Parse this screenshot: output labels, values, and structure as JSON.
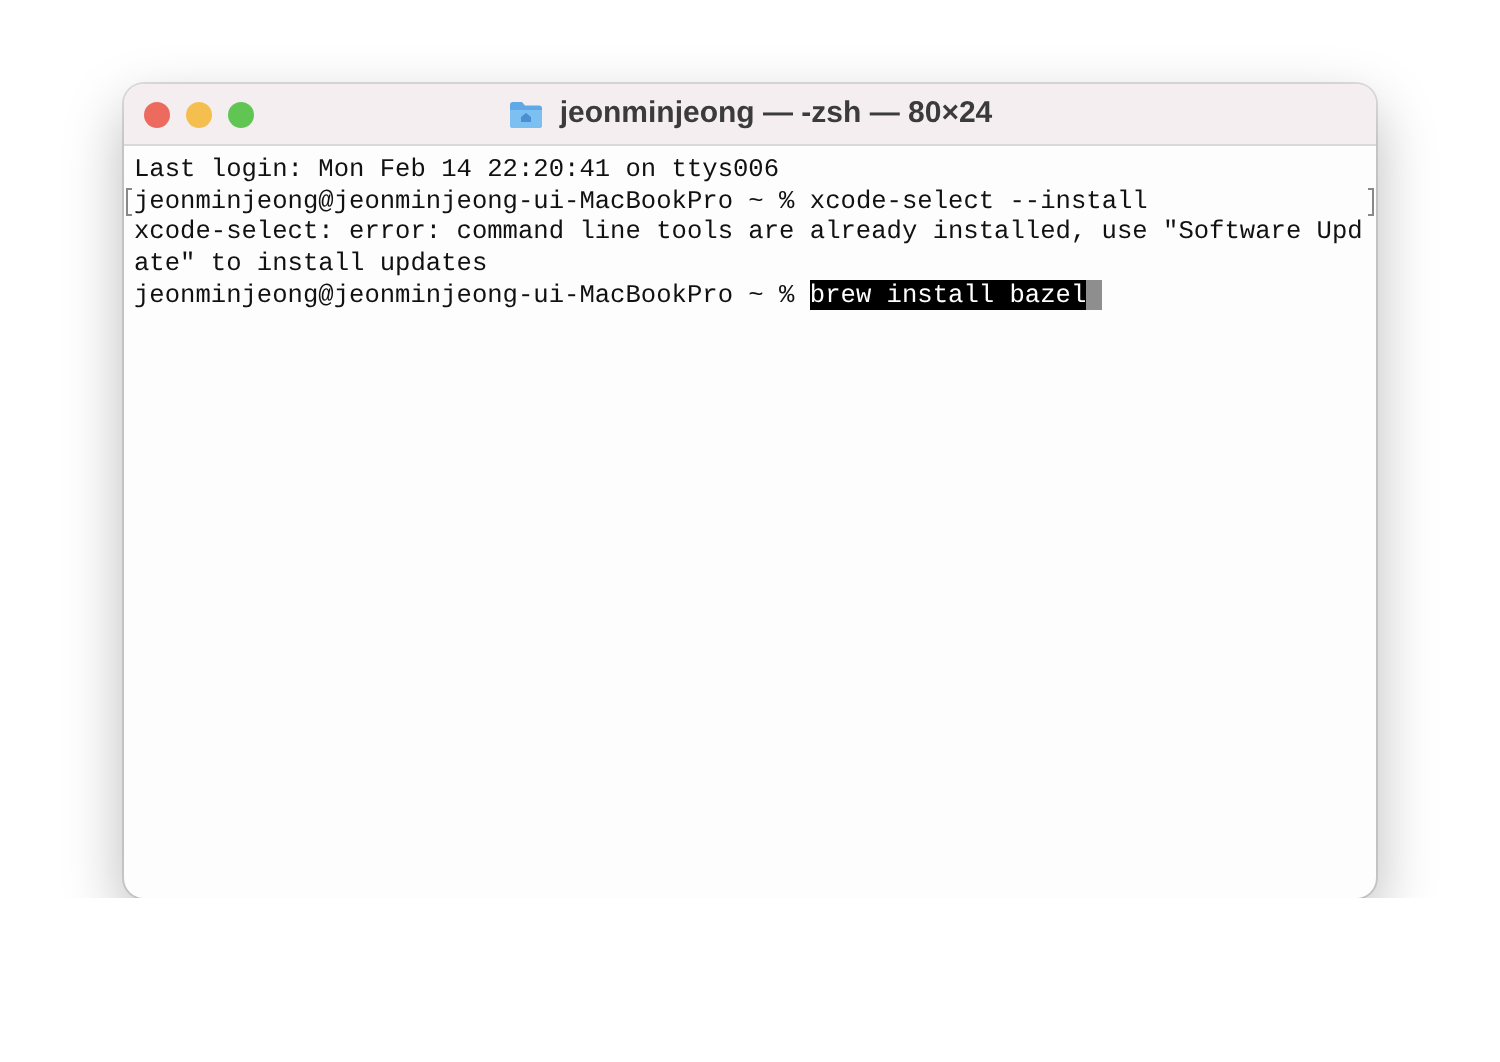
{
  "window": {
    "title": "jeonminjeong — -zsh — 80×24"
  },
  "traffic_lights": [
    {
      "color": "#ed6a5e"
    },
    {
      "color": "#f5bf4f"
    },
    {
      "color": "#61c554"
    }
  ],
  "terminal": {
    "lines": [
      {
        "kind": "output",
        "text": "Last login: Mon Feb 14 22:20:41 on ttys006"
      },
      {
        "kind": "command",
        "prompt": "jeonminjeong@jeonminjeong-ui-MacBookPro ~ %",
        "command": "xcode-select --install",
        "marked": true,
        "highlighted": false,
        "cursor": false
      },
      {
        "kind": "output",
        "text": "xcode-select: error: command line tools are already installed, use \"Software Upd"
      },
      {
        "kind": "output",
        "text": "ate\" to install updates"
      },
      {
        "kind": "command",
        "prompt": "jeonminjeong@jeonminjeong-ui-MacBookPro ~ %",
        "command": "brew install bazel",
        "marked": false,
        "highlighted": true,
        "cursor": true
      }
    ]
  }
}
